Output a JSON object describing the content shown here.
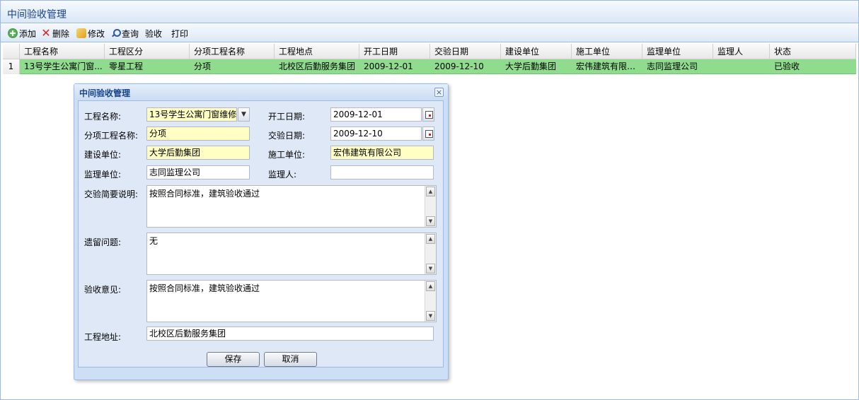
{
  "panel": {
    "title": "中间验收管理"
  },
  "toolbar": {
    "add": "添加",
    "delete": "删除",
    "edit": "修改",
    "query": "查询",
    "accept": "验收",
    "print": "打印"
  },
  "grid": {
    "columns": [
      "工程名称",
      "工程区分",
      "分项工程名称",
      "工程地点",
      "开工日期",
      "交验日期",
      "建设单位",
      "施工单位",
      "监理单位",
      "监理人",
      "状态"
    ],
    "rows": [
      {
        "num": "1",
        "cells": [
          "13号学生公寓门窗...",
          "零星工程",
          "分项",
          "北校区后勤服务集团",
          "2009-12-01",
          "2009-12-10",
          "大学后勤集团",
          "宏伟建筑有限公...",
          "志同监理公司",
          "",
          "已验收"
        ]
      }
    ]
  },
  "dialog": {
    "title": "中间验收管理",
    "close": "×",
    "labels": {
      "project_name": "工程名称:",
      "start_date": "开工日期:",
      "sub_project": "分项工程名称:",
      "handover_date": "交验日期:",
      "builder": "建设单位:",
      "constructor": "施工单位:",
      "supervisor_unit": "监理单位:",
      "supervisor": "监理人:",
      "summary": "交验简要说明:",
      "issues": "遗留问题:",
      "opinion": "验收意见:",
      "address": "工程地址:"
    },
    "values": {
      "project_name": "13号学生公寓门窗维修",
      "start_date": "2009-12-01",
      "sub_project": "分项",
      "handover_date": "2009-12-10",
      "builder": "大学后勤集团",
      "constructor": "宏伟建筑有限公司",
      "supervisor_unit": "志同监理公司",
      "supervisor": "",
      "summary": "按照合同标准，建筑验收通过",
      "issues": "无",
      "opinion": "按照合同标准，建筑验收通过",
      "address": "北校区后勤服务集团"
    },
    "buttons": {
      "save": "保存",
      "cancel": "取消"
    }
  },
  "icons": [
    "add-icon",
    "delete-icon",
    "edit-icon",
    "search-icon",
    "close-icon",
    "chevron-down-icon",
    "calendar-icon"
  ]
}
